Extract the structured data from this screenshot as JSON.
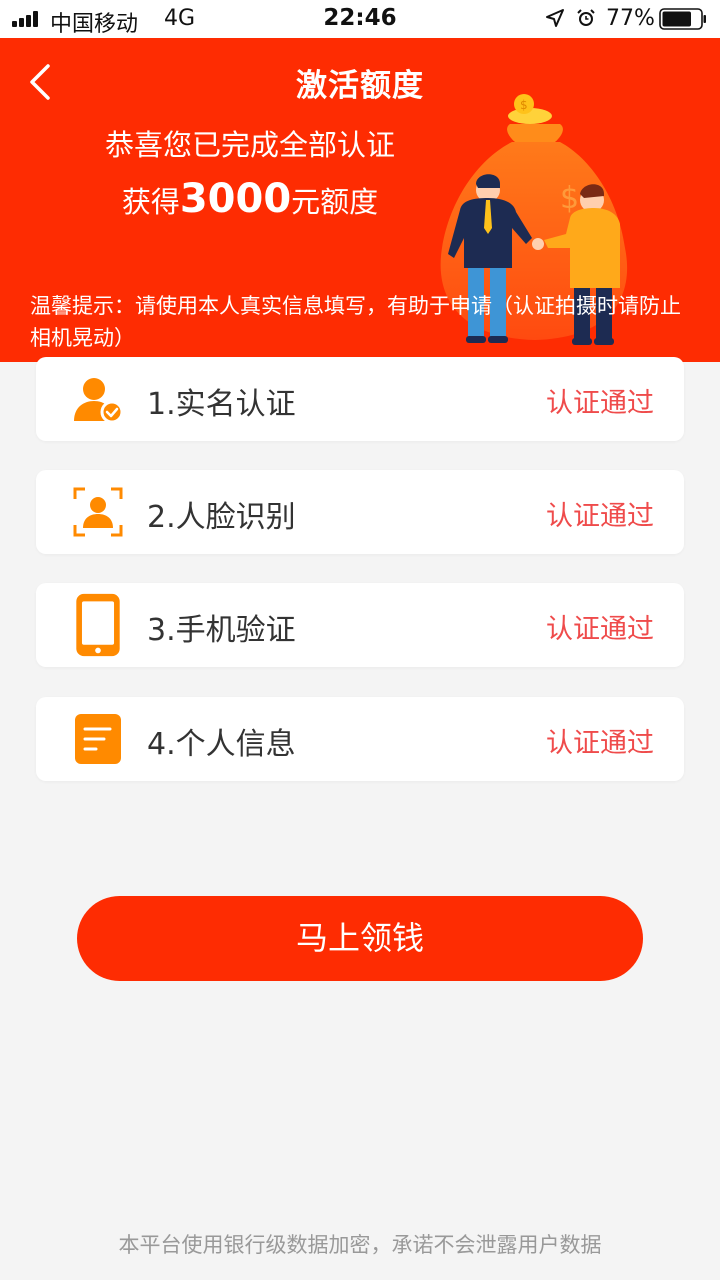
{
  "status_bar": {
    "carrier": "中国移动",
    "network": "4G",
    "time": "22:46",
    "battery": "77%",
    "battery_level": 0.77,
    "icons": [
      "signal-icon",
      "location-icon",
      "alarm-icon",
      "battery-icon"
    ]
  },
  "header": {
    "title": "激活额度",
    "congrats": "恭喜您已完成全部认证",
    "credit_prefix": "获得",
    "credit_amount": "3000",
    "credit_suffix": "元额度",
    "tip": "温馨提示：请使用本人真实信息填写，有助于申请（认证拍摄时请防止相机晃动）",
    "back_icon": "chevron-left-icon"
  },
  "steps": [
    {
      "label": "1.实名认证",
      "status": "认证通过",
      "icon": "user-verified-icon"
    },
    {
      "label": "2.人脸识别",
      "status": "认证通过",
      "icon": "face-scan-icon"
    },
    {
      "label": "3.手机验证",
      "status": "认证通过",
      "icon": "phone-icon"
    },
    {
      "label": "4.个人信息",
      "status": "认证通过",
      "icon": "document-icon"
    }
  ],
  "cta": {
    "label": "马上领钱"
  },
  "footer": {
    "text": "本平台使用银行级数据加密，承诺不会泄露用户数据"
  },
  "colors": {
    "brand_red": "#fe2c02",
    "status_red": "#ef4b4b",
    "icon_orange": "#ff8a00",
    "background": "#f4f4f4"
  }
}
